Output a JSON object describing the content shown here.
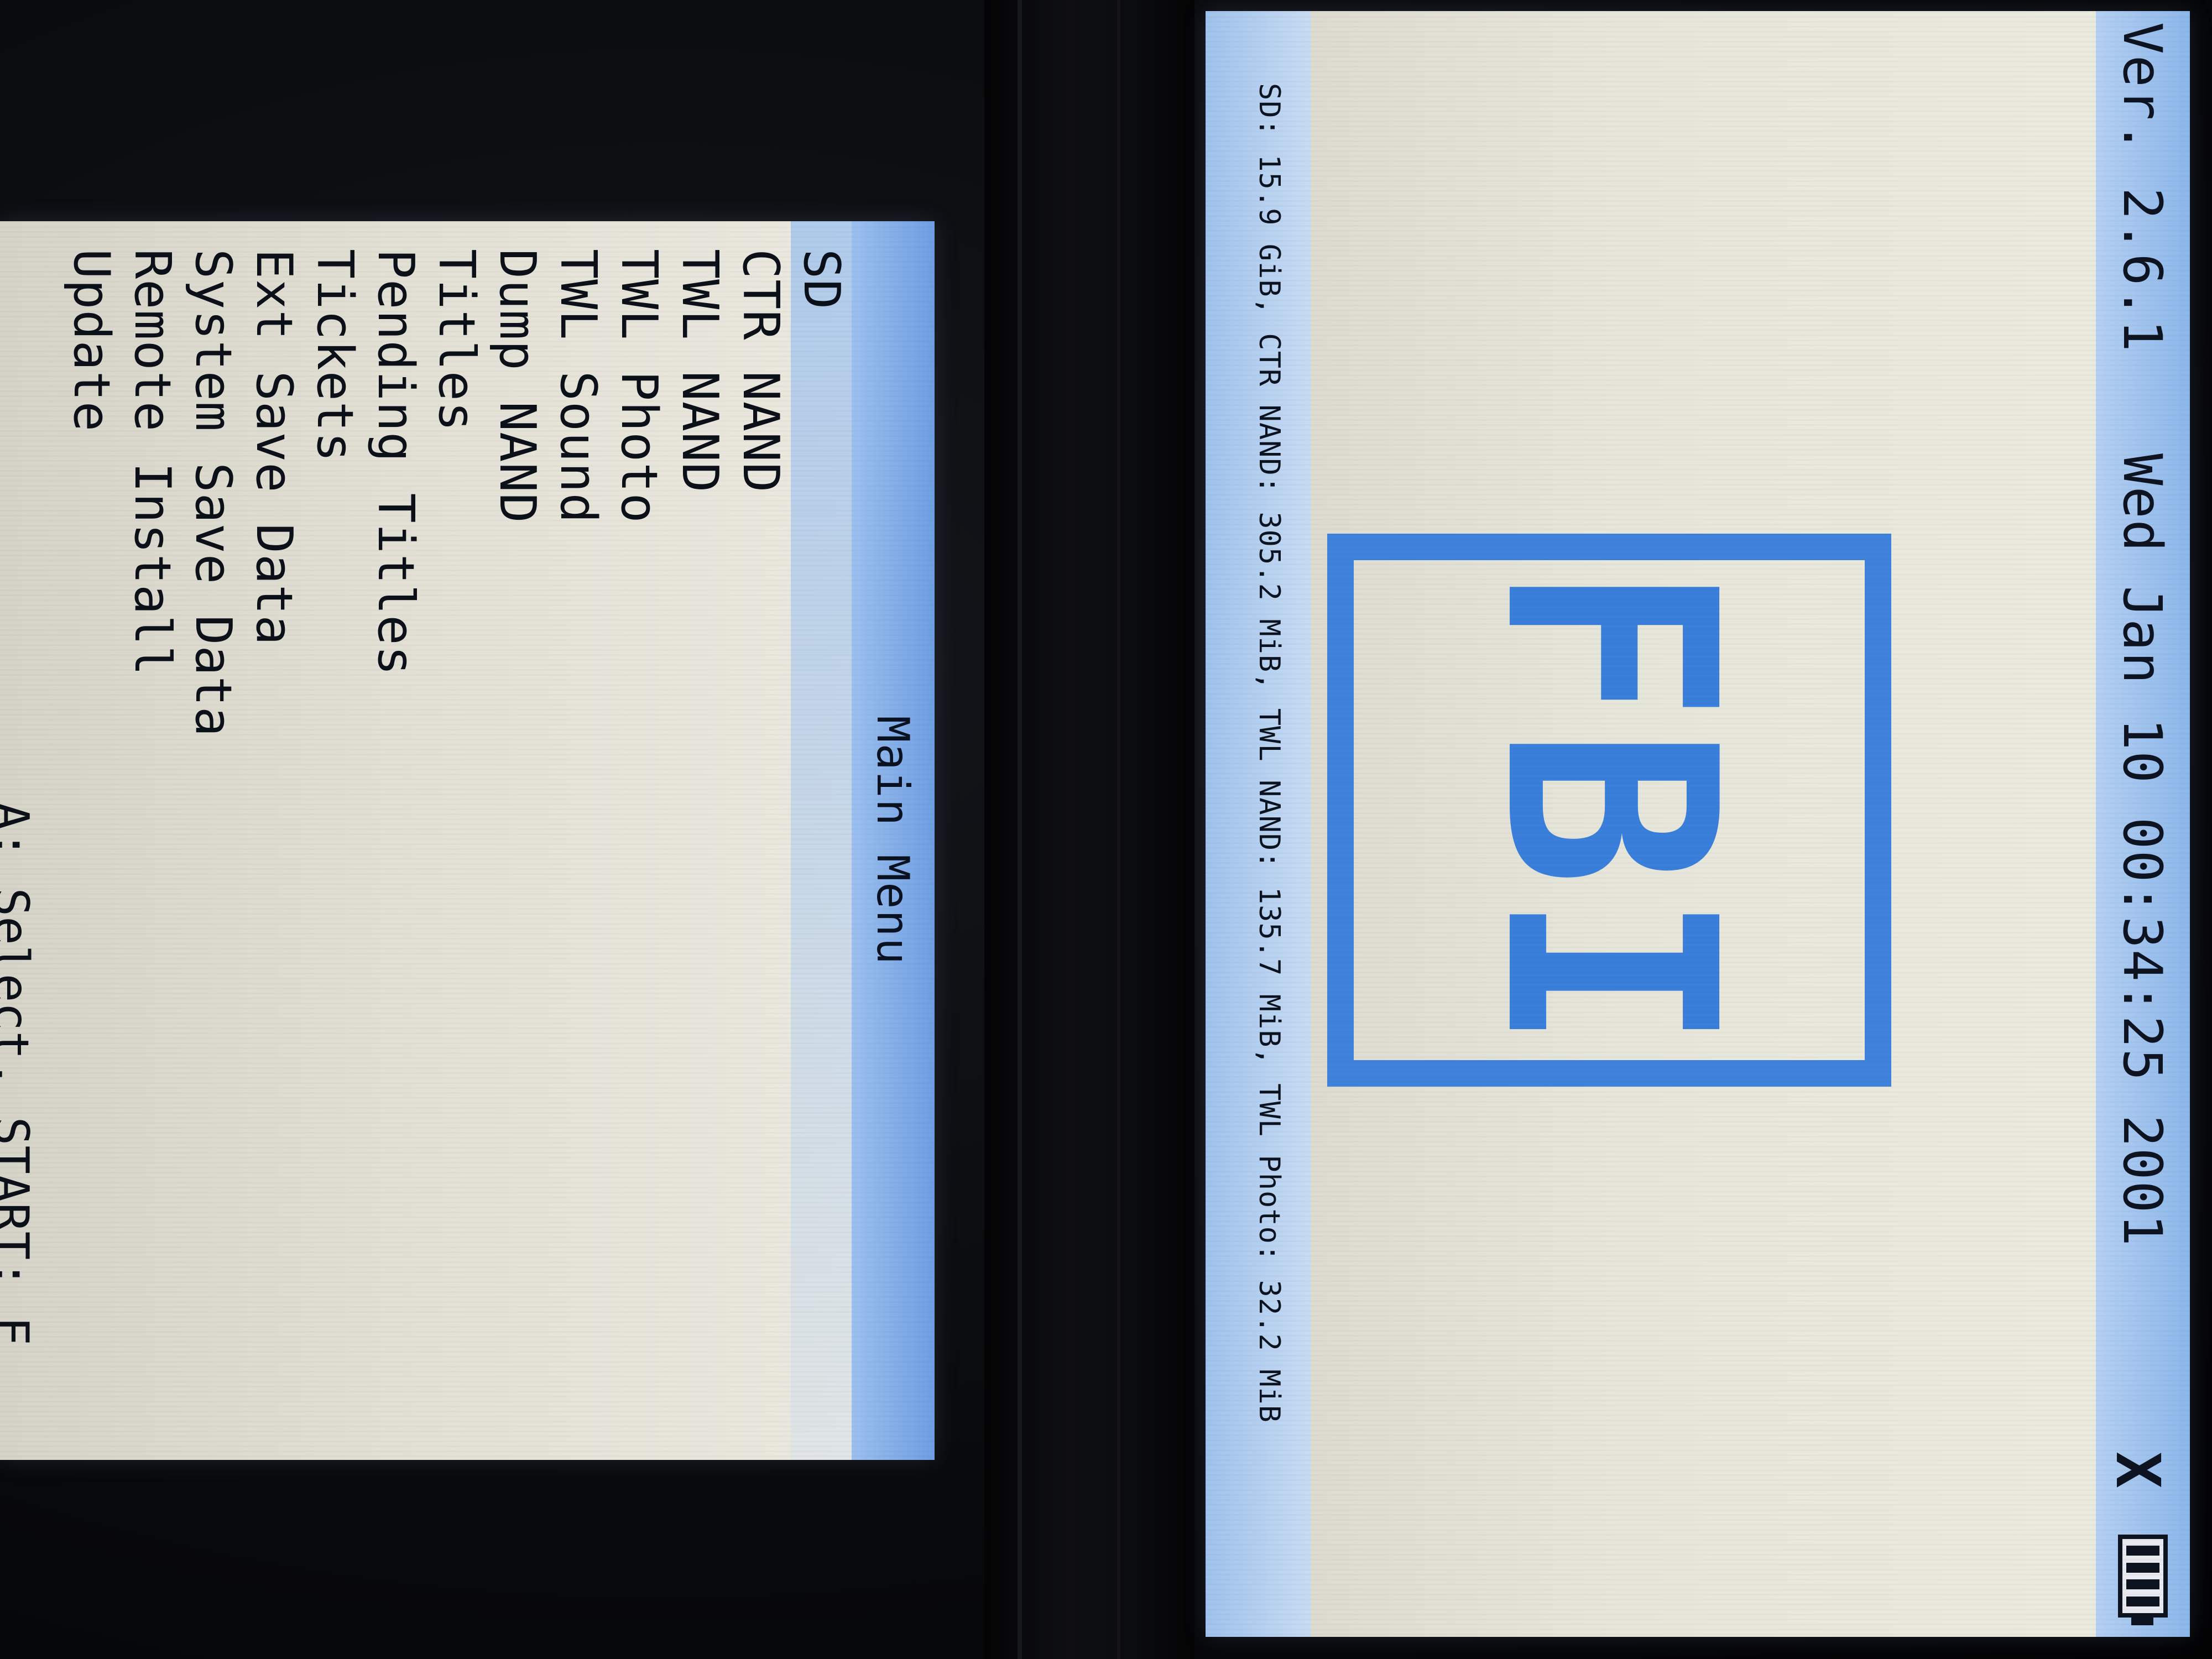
{
  "top_screen": {
    "version": "Ver. 2.6.1",
    "datetime": "Wed Jan 10 00:34:25 2001",
    "wifi_icon": "X",
    "battery_icon": "battery-full-icon",
    "logo": "FBI",
    "storage": "SD: 15.9 GiB, CTR NAND: 305.2 MiB, TWL NAND: 135.7 MiB, TWL Photo: 32.2 MiB"
  },
  "bottom_screen": {
    "title": "Main Menu",
    "items": [
      "SD",
      "CTR NAND",
      "TWL NAND",
      "TWL Photo",
      "TWL Sound",
      "Dump NAND",
      "Titles",
      "Pending Titles",
      "Tickets",
      "Ext Save Data",
      "System Save Data",
      "Remote Install",
      "Update"
    ],
    "hint": "A: Select, START: E"
  },
  "colors": {
    "accent": "#3f82dc",
    "header": "#8cb6ea",
    "background": "#e8e6dc"
  }
}
